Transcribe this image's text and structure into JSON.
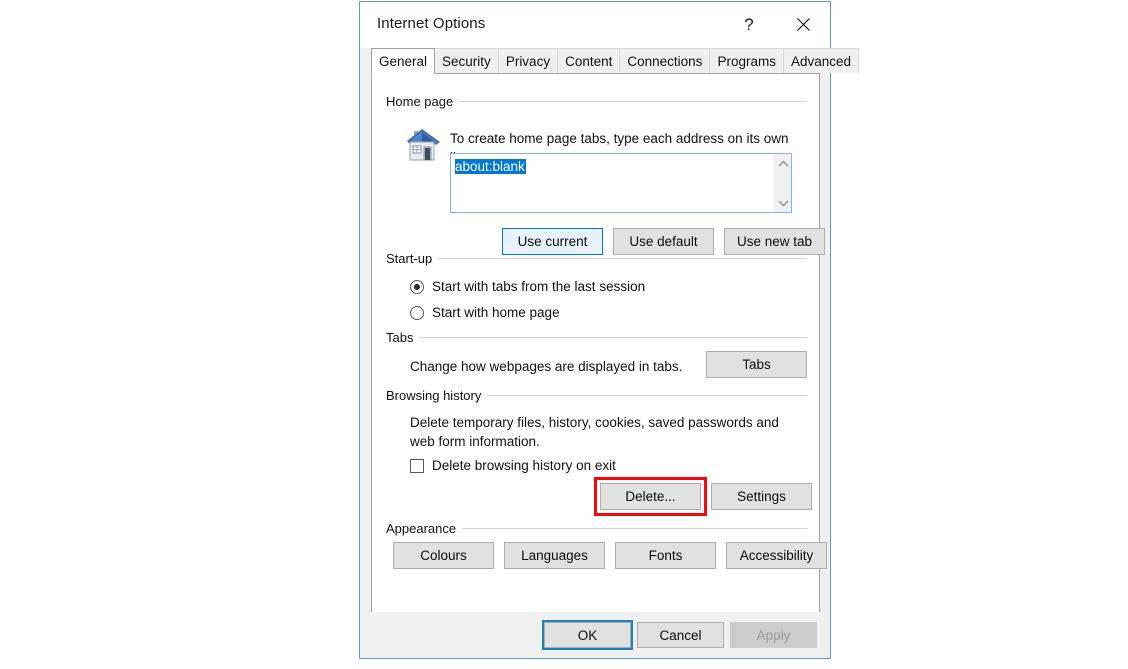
{
  "dialog": {
    "title": "Internet Options",
    "help_icon": "?",
    "close_icon": "close-icon"
  },
  "tabs": [
    {
      "label": "General",
      "active": true
    },
    {
      "label": "Security",
      "active": false
    },
    {
      "label": "Privacy",
      "active": false
    },
    {
      "label": "Content",
      "active": false
    },
    {
      "label": "Connections",
      "active": false
    },
    {
      "label": "Programs",
      "active": false
    },
    {
      "label": "Advanced",
      "active": false
    }
  ],
  "home_page": {
    "group_label": "Home page",
    "icon": "house-icon",
    "instruction": "To create home page tabs, type each address on its own line.",
    "url_value": "about:blank",
    "url_selected": true,
    "scroll_up_icon": "chevron-up-icon",
    "scroll_down_icon": "chevron-down-icon",
    "buttons": {
      "use_current": "Use current",
      "use_default": "Use default",
      "use_new_tab": "Use new tab"
    }
  },
  "startup": {
    "group_label": "Start-up",
    "options": [
      {
        "label": "Start with tabs from the last session",
        "checked": true
      },
      {
        "label": "Start with home page",
        "checked": false
      }
    ]
  },
  "tabs_group": {
    "group_label": "Tabs",
    "description": "Change how webpages are displayed in tabs.",
    "button": "Tabs"
  },
  "browsing_history": {
    "group_label": "Browsing history",
    "description": "Delete temporary files, history, cookies, saved passwords and web form information.",
    "checkbox_label": "Delete browsing history on exit",
    "checkbox_checked": false,
    "delete_button": "Delete...",
    "settings_button": "Settings",
    "highlight_color": "#fb0505"
  },
  "appearance": {
    "group_label": "Appearance",
    "buttons": [
      "Colours",
      "Languages",
      "Fonts",
      "Accessibility"
    ]
  },
  "footer": {
    "ok": "OK",
    "cancel": "Cancel",
    "apply": "Apply",
    "apply_disabled": true
  },
  "colors": {
    "accent": "#0078d7",
    "focus_ring": "#2080c4",
    "dialog_border": "#5b9bd5",
    "button_face": "#e1e1e1",
    "highlight_red": "#fb0505"
  }
}
